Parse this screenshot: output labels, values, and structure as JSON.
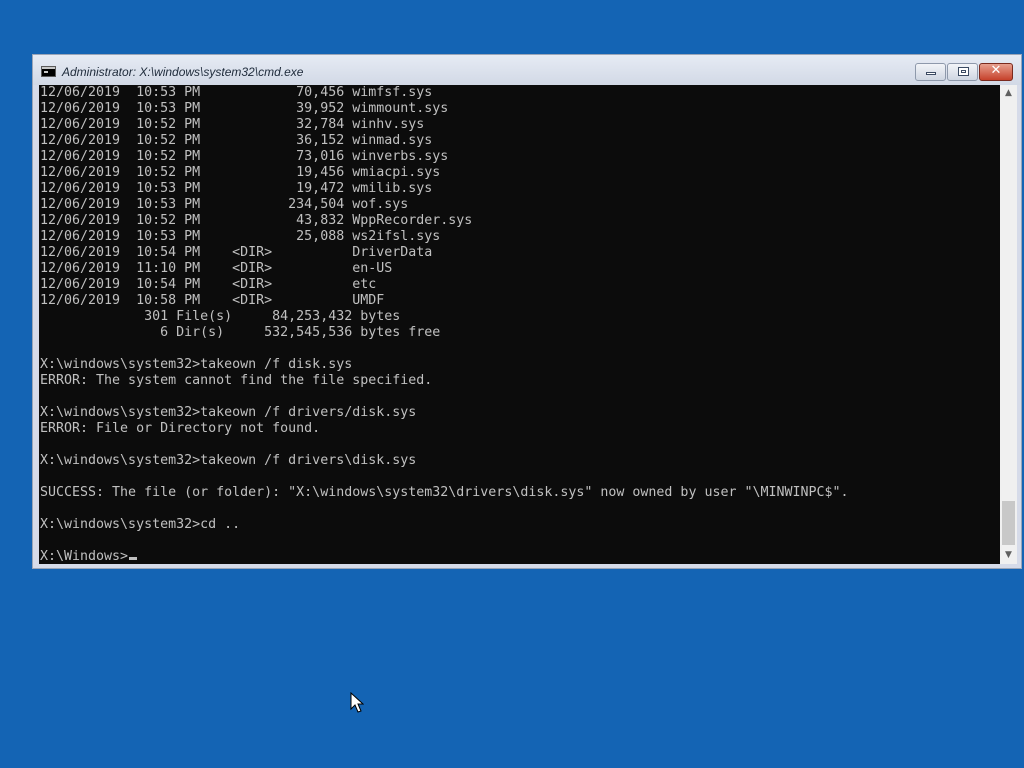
{
  "window": {
    "title": "Administrator: X:\\windows\\system32\\cmd.exe",
    "icon": "cmd-icon",
    "controls": {
      "minimize": "minimize-icon",
      "maximize": "maximize-icon",
      "close": "✕"
    }
  },
  "console": {
    "lines": [
      "12/06/2019  10:53 PM            70,456 wimfsf.sys",
      "12/06/2019  10:53 PM            39,952 wimmount.sys",
      "12/06/2019  10:52 PM            32,784 winhv.sys",
      "12/06/2019  10:52 PM            36,152 winmad.sys",
      "12/06/2019  10:52 PM            73,016 winverbs.sys",
      "12/06/2019  10:52 PM            19,456 wmiacpi.sys",
      "12/06/2019  10:53 PM            19,472 wmilib.sys",
      "12/06/2019  10:53 PM           234,504 wof.sys",
      "12/06/2019  10:52 PM            43,832 WppRecorder.sys",
      "12/06/2019  10:53 PM            25,088 ws2ifsl.sys",
      "12/06/2019  10:54 PM    <DIR>          DriverData",
      "12/06/2019  11:10 PM    <DIR>          en-US",
      "12/06/2019  10:54 PM    <DIR>          etc",
      "12/06/2019  10:58 PM    <DIR>          UMDF",
      "             301 File(s)     84,253,432 bytes",
      "               6 Dir(s)     532,545,536 bytes free",
      "",
      "X:\\windows\\system32>takeown /f disk.sys",
      "ERROR: The system cannot find the file specified.",
      "",
      "X:\\windows\\system32>takeown /f drivers/disk.sys",
      "ERROR: File or Directory not found.",
      "",
      "X:\\windows\\system32>takeown /f drivers\\disk.sys",
      "",
      "SUCCESS: The file (or folder): \"X:\\windows\\system32\\drivers\\disk.sys\" now owned by user \"\\MINWINPC$\".",
      "",
      "X:\\windows\\system32>cd ..",
      ""
    ],
    "prompt": "X:\\Windows>",
    "input": ""
  },
  "scrollbar": {
    "up": "▲",
    "down": "▼",
    "position": 0.93
  },
  "colors": {
    "desktop": "#1464b4",
    "console_bg": "#0c0c0c",
    "console_text": "#c0c0c0"
  }
}
